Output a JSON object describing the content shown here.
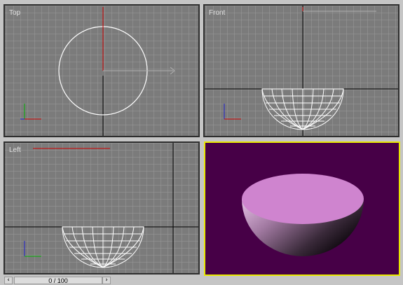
{
  "viewports": {
    "top": {
      "label": "Top"
    },
    "front": {
      "label": "Front"
    },
    "left": {
      "label": "Left"
    },
    "perspective": {
      "label": ""
    }
  },
  "axis_labels": {
    "x": "x",
    "y": "y",
    "z": "z"
  },
  "time_slider": {
    "value": "0 / 100",
    "prev_icon": "chevron-left-icon",
    "next_icon": "chevron-right-icon"
  },
  "colors": {
    "viewport_bg": "#7b7b7b",
    "grid_line": "#9b9b9b",
    "wireframe": "#ffffff",
    "active_border": "#e8e800",
    "shaded_bg": "#470047",
    "object_color": "#cf84cf"
  }
}
